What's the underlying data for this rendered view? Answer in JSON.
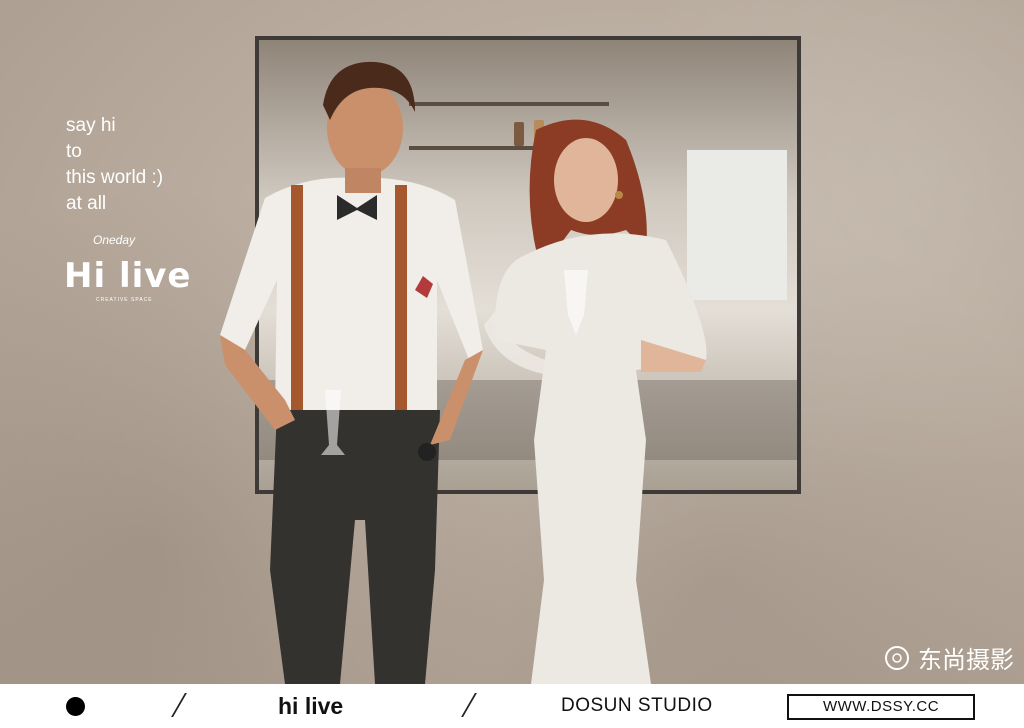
{
  "overlay": {
    "tagline": [
      "say hi",
      "to",
      "this world :)",
      "at all"
    ],
    "logo_small": "Oneday",
    "logo_brand": "Hi live",
    "logo_sub": "CREATIVE SPACE",
    "watermark": "东尚摄影"
  },
  "footer": {
    "brand": "hi live",
    "studio": "DOSUN STUDIO",
    "url": "WWW.DSSY.CC"
  },
  "icons": [
    "dot-icon",
    "slash-icon",
    "watermark-logo-icon"
  ]
}
